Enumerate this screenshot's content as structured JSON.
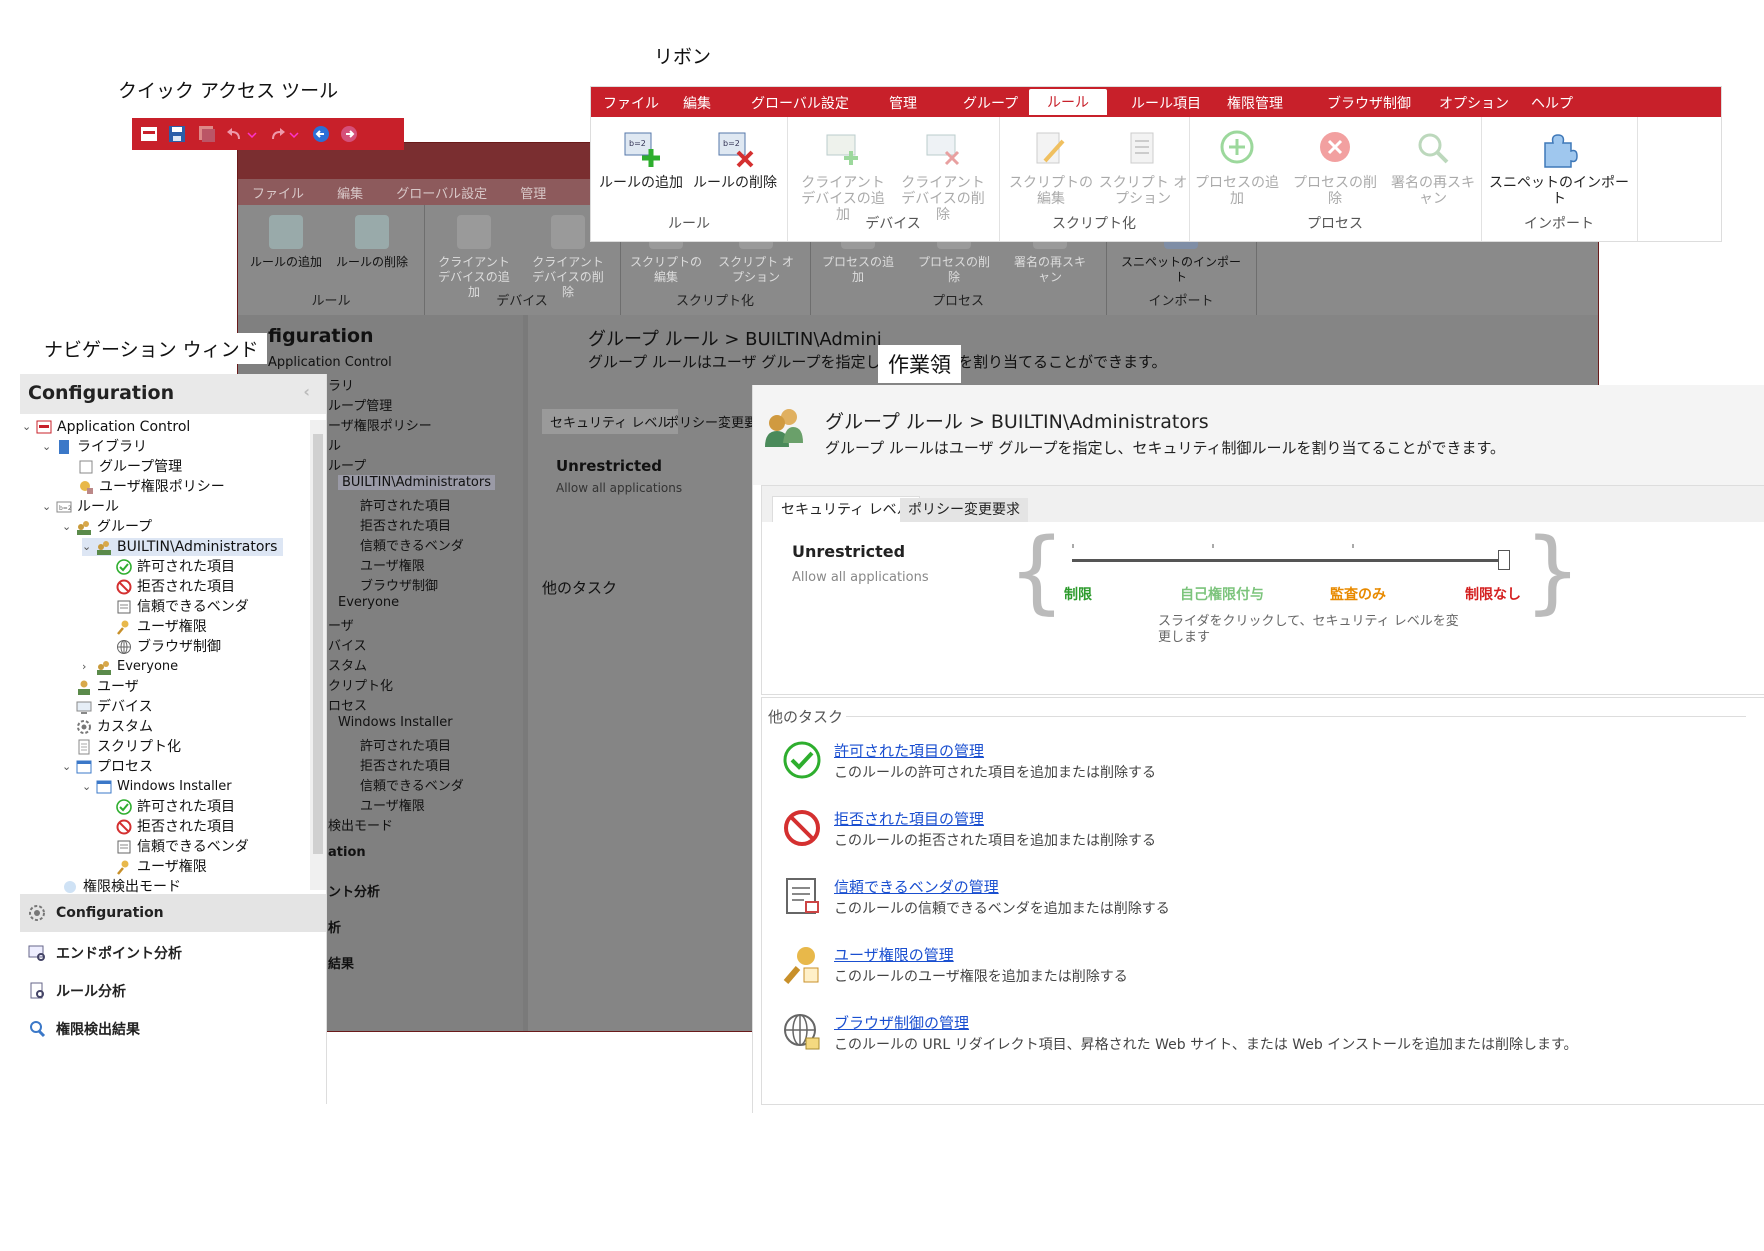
{
  "callouts": {
    "ribbon": "リボン",
    "quick_access": "クイック アクセス ツール",
    "navigation": "ナビゲーション ウィンド",
    "workspace": "作業領"
  },
  "colors": {
    "accent": "#c8202a",
    "link": "#1a4fd0",
    "green": "#2e9b2e",
    "orange": "#e88a00",
    "red": "#d42020"
  },
  "ribbon": {
    "tabs": [
      "ファイル",
      "編集",
      "グローバル設定",
      "管理",
      "グループ",
      "ルール",
      "ルール項目",
      "権限管理",
      "ブラウザ制御",
      "オプション",
      "ヘルプ"
    ],
    "active_tab": "ルール",
    "groups": [
      {
        "label": "ルール",
        "buttons": [
          {
            "text": "ルールの追加",
            "icon": "add-rule-icon"
          },
          {
            "text": "ルールの削除",
            "icon": "delete-rule-icon"
          }
        ]
      },
      {
        "label": "デバイス",
        "buttons": [
          {
            "text": "クライアント デバイスの追加",
            "icon": "add-device-icon"
          },
          {
            "text": "クライアント デバイスの削除",
            "icon": "delete-device-icon"
          }
        ]
      },
      {
        "label": "スクリプト化",
        "buttons": [
          {
            "text": "スクリプトの編集",
            "icon": "edit-script-icon"
          },
          {
            "text": "スクリプト オプション",
            "icon": "script-options-icon"
          }
        ]
      },
      {
        "label": "プロセス",
        "buttons": [
          {
            "text": "プロセスの追加",
            "icon": "add-process-icon"
          },
          {
            "text": "プロセスの削除",
            "icon": "delete-process-icon"
          },
          {
            "text": "署名の再スキャン",
            "icon": "rescan-icon"
          }
        ]
      },
      {
        "label": "インポート",
        "buttons": [
          {
            "text": "スニペットのインポート",
            "icon": "puzzle-icon"
          }
        ]
      }
    ]
  },
  "nav": {
    "title": "Configuration",
    "tree": [
      "Application Control",
      "ライブラリ",
      "グループ管理",
      "ユーザ権限ポリシー",
      "ルール",
      "グループ",
      "BUILTIN\\Administrators",
      "許可された項目",
      "拒否された項目",
      "信頼できるベンダ",
      "ユーザ権限",
      "ブラウザ制御",
      "Everyone",
      "ユーザ",
      "デバイス",
      "カスタム",
      "スクリプト化",
      "プロセス",
      "Windows Installer",
      "許可された項目",
      "拒否された項目",
      "信頼できるベンダ",
      "ユーザ権限",
      "権限検出モード"
    ],
    "sections": [
      "Configuration",
      "エンドポイント分析",
      "ルール分析",
      "権限検出結果"
    ]
  },
  "work": {
    "title": "グループ ルール > BUILTIN\\Administrators",
    "subtitle": "グループ ルールはユーザ グループを指定し、セキュリティ制御ルールを割り当てることができます。",
    "tabs": [
      "セキュリティ レベル",
      "ポリシー変更要求"
    ],
    "level_name": "Unrestricted",
    "level_desc": "Allow all applications",
    "slider_labels": [
      "制限",
      "自己権限付与",
      "監査のみ",
      "制限なし"
    ],
    "slider_value": 3,
    "slider_hint": "スライダをクリックして、セキュリティ レベルを変更します",
    "other_tasks_title": "他のタスク",
    "tasks": [
      {
        "link": "許可された項目の管理",
        "desc": "このルールの許可された項目を追加または削除する",
        "icon": "check-icon"
      },
      {
        "link": "拒否された項目の管理",
        "desc": "このルールの拒否された項目を追加または削除する",
        "icon": "deny-icon"
      },
      {
        "link": "信頼できるベンダの管理",
        "desc": "このルールの信頼できるベンダを追加または削除する",
        "icon": "vendor-icon"
      },
      {
        "link": "ユーザ権限の管理",
        "desc": "このルールのユーザ権限を追加または削除する",
        "icon": "user-key-icon"
      },
      {
        "link": "ブラウザ制御の管理",
        "desc": "このルールの URL リダイレクト項目、昇格された Web サイト、または Web インストールを追加または削除します。",
        "icon": "globe-icon"
      }
    ]
  },
  "bg": {
    "title_fragment": "figuration",
    "header_fragment": "グループ ルール > BUILTIN\\Admini",
    "subtitle_fragment": "グループ ルールはユーザ グループを指定し、",
    "subtitle_tail": "ールを割り当てることができます。",
    "tree_root": "Application Control",
    "tree": [
      "ラリ",
      "ループ管理",
      "ーザ権限ポリシー",
      "ル",
      "ループ",
      "BUILTIN\\Administrators",
      "許可された項目",
      "拒否された項目",
      "信頼できるベンダ",
      "ユーザ権限",
      "ブラウザ制御",
      "Everyone",
      "ーザ",
      "バイス",
      "スタム",
      "クリプト化",
      "ロセス",
      "Windows Installer",
      "許可された項目",
      "拒否された項目",
      "信頼できるベンダ",
      "ユーザ権限",
      "検出モード"
    ],
    "sections": [
      "ation",
      "ント分析",
      "析",
      "結果"
    ],
    "tasks_title": "他のタスク",
    "tab_fragment": "ポリシー変更要求"
  }
}
